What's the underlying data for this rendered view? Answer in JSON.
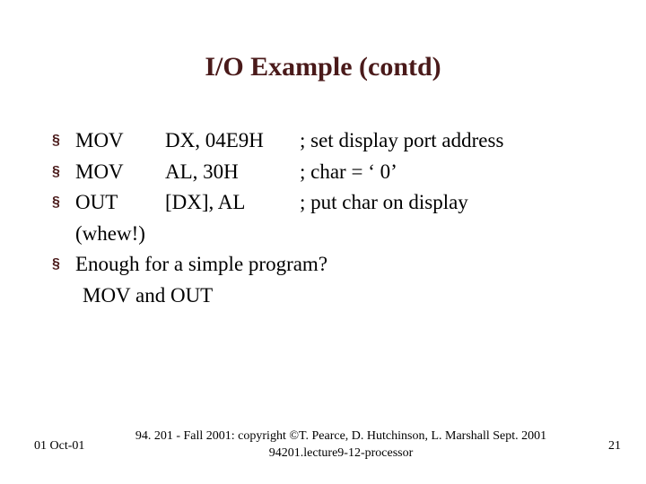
{
  "title": "I/O Example (contd)",
  "bullets": {
    "b1": {
      "instr": "MOV",
      "args": "DX,  04E9H",
      "comment": "; set display port address"
    },
    "b2": {
      "instr": "MOV",
      "args": "AL, 30H",
      "comment": "; char = ‘ 0’"
    },
    "b3": {
      "instr": "OUT",
      "args": "[DX], AL",
      "comment": "; put char on display"
    },
    "cont1": "(whew!)",
    "b4": "Enough for a simple program?",
    "cont2": " MOV and OUT"
  },
  "footer": {
    "date": "01 Oct-01",
    "center1": "94. 201 - Fall 2001: copyright ©T. Pearce, D. Hutchinson, L. Marshall Sept. 2001",
    "center2": "94201.lecture9-12-processor",
    "pagenum": "21"
  },
  "bullet_char": "§"
}
